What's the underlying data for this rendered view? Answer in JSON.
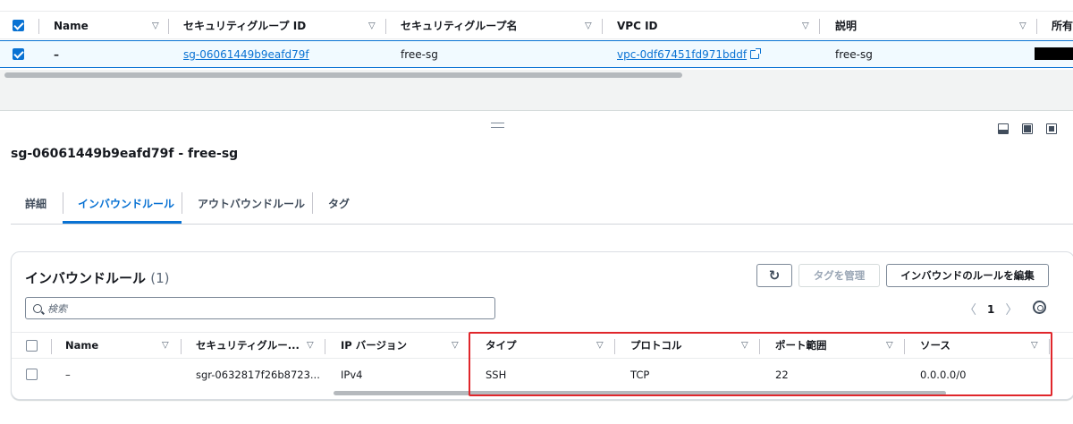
{
  "top_table": {
    "columns": [
      "Name",
      "セキュリティグループ ID",
      "セキュリティグループ名",
      "VPC ID",
      "説明",
      "所有"
    ],
    "row": {
      "name": "–",
      "sg_id": "sg-06061449b9eafd79f",
      "sg_name": "free-sg",
      "vpc_id": "vpc-0df67451fd971bddf",
      "description": "free-sg"
    }
  },
  "panel": {
    "title": "sg-06061449b9eafd79f - free-sg",
    "tabs": [
      "詳細",
      "インバウンドルール",
      "アウトバウンドルール",
      "タグ"
    ],
    "active_tab": "インバウンドルール"
  },
  "inbound": {
    "title": "インバウンドルール",
    "count": "(1)",
    "buttons": {
      "manage_tags": "タグを管理",
      "edit_rules": "インバウンドのルールを編集"
    },
    "search_placeholder": "検索",
    "page": "1",
    "columns": [
      "Name",
      "セキュリティグルー...",
      "IP バージョン",
      "タイプ",
      "プロトコル",
      "ポート範囲",
      "ソース"
    ],
    "rows": [
      {
        "name": "–",
        "rule_id": "sgr-0632817f26b8723...",
        "ip_version": "IPv4",
        "type": "SSH",
        "protocol": "TCP",
        "port_range": "22",
        "source": "0.0.0.0/0"
      }
    ]
  },
  "colors": {
    "accent": "#0972d3",
    "highlight": "#e0262b"
  }
}
